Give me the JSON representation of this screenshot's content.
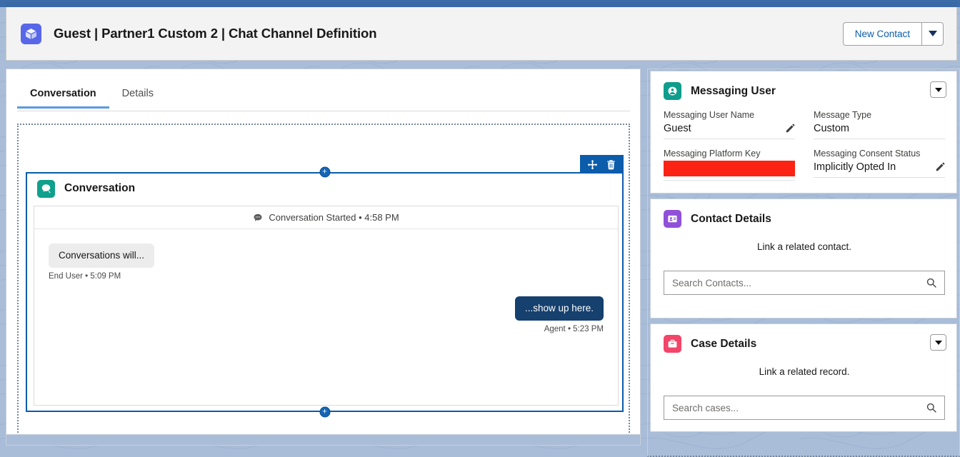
{
  "header": {
    "app_icon": "cube-icon",
    "title": "Guest | Partner1 Custom 2 | Chat Channel Definition",
    "new_contact_label": "New Contact",
    "caret_icon": "chevron-down-icon"
  },
  "left_panel": {
    "tabs": [
      {
        "label": "Conversation",
        "active": true
      },
      {
        "label": "Details",
        "active": false
      }
    ],
    "component": {
      "icon": "chat-bubble-icon",
      "title": "Conversation",
      "toolbar": {
        "move_icon": "move-icon",
        "delete_icon": "trash-icon"
      },
      "handles": {
        "top": "+",
        "bottom": "+"
      },
      "conversation": {
        "started_icon": "chat-bubble-icon",
        "started_text": "Conversation Started • 4:58 PM",
        "messages": [
          {
            "direction": "inbound",
            "text": "Conversations will...",
            "meta": "End User • 5:09 PM"
          },
          {
            "direction": "outbound",
            "text": "...show up here.",
            "meta": "Agent • 5:23 PM"
          }
        ]
      }
    }
  },
  "right_panel": {
    "cards": [
      {
        "id": "messaging-user",
        "icon": "messaging-user-icon",
        "icon_color": "#0f9d8c",
        "title": "Messaging User",
        "has_menu": true,
        "menu_icon": "chevron-down-icon",
        "fields": [
          {
            "label": "Messaging User Name",
            "value": "Guest",
            "editable": true,
            "edit_icon": "pencil-icon",
            "redacted": false
          },
          {
            "label": "Message Type",
            "value": "Custom",
            "editable": false,
            "redacted": false
          },
          {
            "label": "Messaging Platform Key",
            "value": "",
            "editable": false,
            "redacted": true,
            "redaction_color": "#fc2314"
          },
          {
            "label": "Messaging Consent Status",
            "value": "Implicitly Opted In",
            "editable": true,
            "edit_icon": "pencil-icon",
            "redacted": false
          }
        ]
      },
      {
        "id": "contact-details",
        "icon": "contact-card-icon",
        "icon_color": "#9050d9",
        "title": "Contact Details",
        "has_menu": false,
        "hint": "Link a related contact.",
        "search_placeholder": "Search Contacts...",
        "search_value": "",
        "search_icon": "search-icon"
      },
      {
        "id": "case-details",
        "icon": "briefcase-icon",
        "icon_color": "#f2456a",
        "title": "Case Details",
        "has_menu": true,
        "menu_icon": "chevron-down-icon",
        "hint": "Link a related record.",
        "search_placeholder": "Search cases...",
        "search_value": "",
        "search_icon": "search-icon"
      }
    ]
  },
  "colors": {
    "page_background": "#a9bdd8",
    "top_band": "#3d6da8",
    "accent_blue": "#0b5cab",
    "tab_underline": "#5a9ae0",
    "agent_bubble": "#16406e",
    "end_user_bubble": "#ececec"
  }
}
